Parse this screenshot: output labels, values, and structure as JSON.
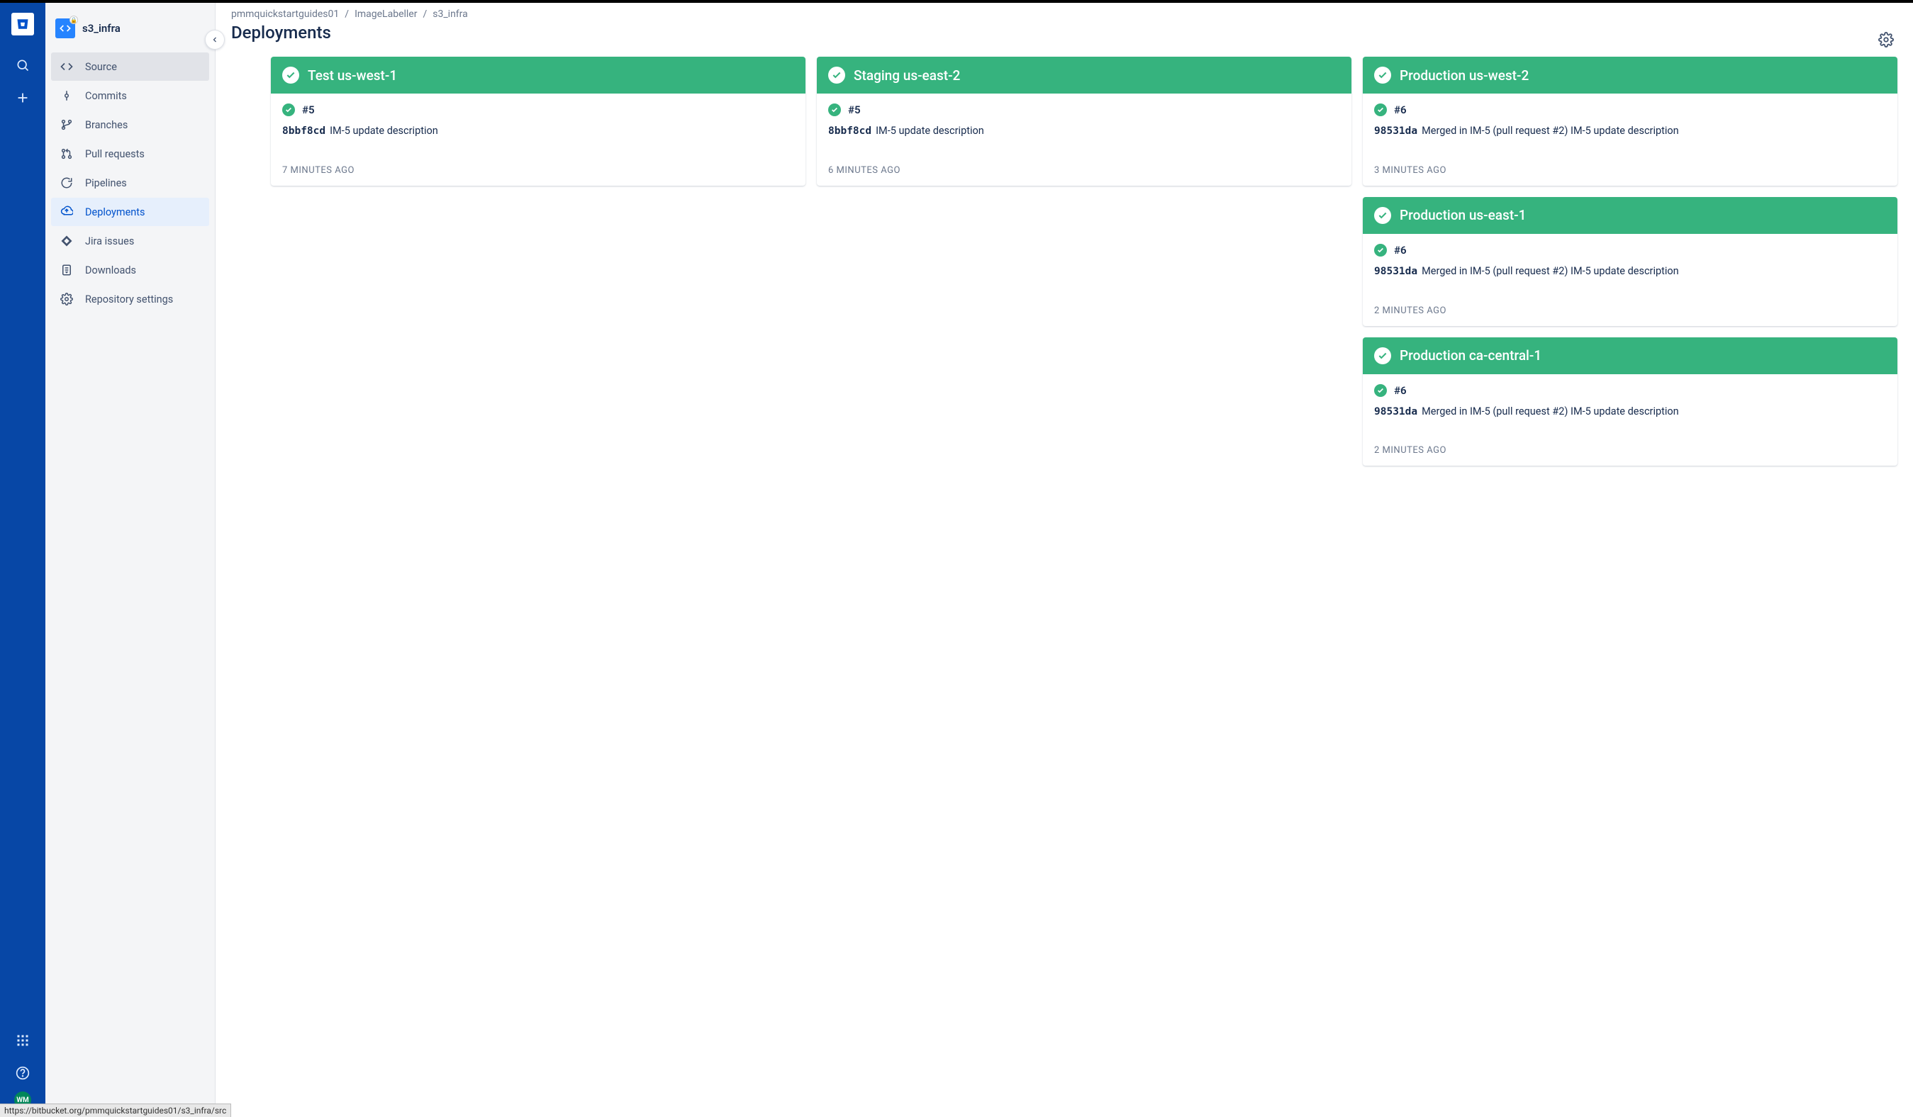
{
  "globalNav": {
    "avatar_initials": "WM"
  },
  "repo": {
    "name": "s3_infra"
  },
  "sidebar": {
    "items": [
      {
        "label": "Source",
        "icon": "code",
        "state": "active"
      },
      {
        "label": "Commits",
        "icon": "commit",
        "state": ""
      },
      {
        "label": "Branches",
        "icon": "branch",
        "state": ""
      },
      {
        "label": "Pull requests",
        "icon": "pullrequest",
        "state": ""
      },
      {
        "label": "Pipelines",
        "icon": "pipeline",
        "state": ""
      },
      {
        "label": "Deployments",
        "icon": "deploy",
        "state": "selected"
      },
      {
        "label": "Jira issues",
        "icon": "jira",
        "state": ""
      },
      {
        "label": "Downloads",
        "icon": "download",
        "state": ""
      },
      {
        "label": "Repository settings",
        "icon": "settings",
        "state": ""
      }
    ]
  },
  "breadcrumb": [
    "pmmquickstartguides01",
    "ImageLabeller",
    "s3_infra"
  ],
  "page_title": "Deployments",
  "columns": [
    [
      {
        "name": "Test us-west-1",
        "build": "#5",
        "commit": "8bbf8cd",
        "message": "IM-5 update description",
        "time": "7 MINUTES AGO"
      }
    ],
    [
      {
        "name": "Staging us-east-2",
        "build": "#5",
        "commit": "8bbf8cd",
        "message": "IM-5 update description",
        "time": "6 MINUTES AGO"
      }
    ],
    [
      {
        "name": "Production us-west-2",
        "build": "#6",
        "commit": "98531da",
        "message": "Merged in IM-5 (pull request #2) IM-5 update description",
        "time": "3 MINUTES AGO"
      },
      {
        "name": "Production us-east-1",
        "build": "#6",
        "commit": "98531da",
        "message": "Merged in IM-5 (pull request #2) IM-5 update description",
        "time": "2 MINUTES AGO"
      },
      {
        "name": "Production ca-central-1",
        "build": "#6",
        "commit": "98531da",
        "message": "Merged in IM-5 (pull request #2) IM-5 update description",
        "time": "2 MINUTES AGO"
      }
    ]
  ],
  "status_url": "https://bitbucket.org/pmmquickstartguides01/s3_infra/src"
}
